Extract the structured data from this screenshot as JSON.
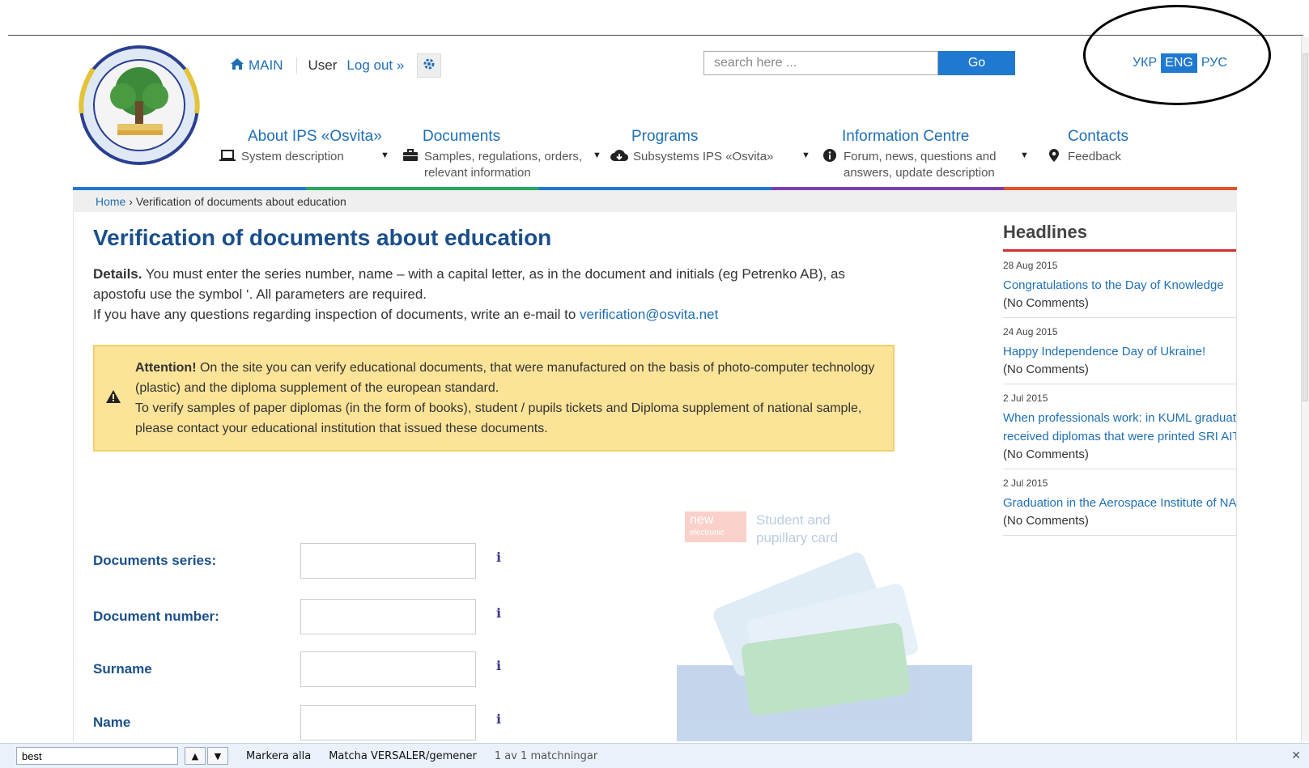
{
  "header": {
    "main_label": "MAIN",
    "user_label": "User",
    "logout_label": "Log out »",
    "search_placeholder": "search here ...",
    "search_button": "Go",
    "languages": [
      "УКР",
      "ENG",
      "РУС"
    ],
    "active_language": "ENG"
  },
  "nav": [
    {
      "title": "About IPS «Osvita»",
      "sub": "System description",
      "icon": "laptop-icon"
    },
    {
      "title": "Documents",
      "sub": "Samples, regulations, orders, relevant information",
      "icon": "briefcase-icon"
    },
    {
      "title": "Programs",
      "sub": "Subsystems IPS «Osvita»",
      "icon": "cloud-download-icon"
    },
    {
      "title": "Information Centre",
      "sub": "Forum, news, questions and answers, update description",
      "icon": "info-circle-icon"
    },
    {
      "title": "Contacts",
      "sub": "Feedback",
      "icon": "map-marker-icon"
    }
  ],
  "nav_colors": [
    "#1f79d0",
    "#2aa860",
    "#1f79d0",
    "#7b3fb0",
    "#e0532a"
  ],
  "breadcrumb": {
    "home": "Home",
    "separator": "›",
    "current": "Verification of documents about education"
  },
  "page": {
    "title": "Verification of documents about education",
    "details_bold": "Details.",
    "details_text": "You must enter the series number, name – with a capital letter, as in the document and initials (eg Petrenko AB), as apostofu use the symbol ‘. All parameters are required.",
    "contact_text": "If you have any questions regarding inspection of documents, write an e-mail to",
    "contact_email": "verification@osvita.net"
  },
  "alert": {
    "bold": "Attention!",
    "line1": "On the site you can verify educational documents, that were manufactured on the basis of photo-computer technology (plastic) and the diploma supplement of the european standard.",
    "line2": "To verify samples of paper diplomas (in the form of books), student / pupils tickets and Diploma supplement of national sample, please contact your educational institution that issued these documents."
  },
  "form": {
    "fields": [
      "Documents series:",
      "Document number:",
      "Surname",
      "Name"
    ],
    "info_symbol": "i"
  },
  "promo": {
    "new": "new",
    "electronic": "electronic",
    "text1": "Student and",
    "text2": "pupillary card"
  },
  "sidebar": {
    "title": "Headlines",
    "news": [
      {
        "date": "28 Aug 2015",
        "title": "Congratulations to the Day of Knowledge",
        "comments": "(No Comments)"
      },
      {
        "date": "24 Aug 2015",
        "title": "Happy Independence Day of Ukraine!",
        "comments": "(No Comments)"
      },
      {
        "date": "2 Jul 2015",
        "title": "When professionals work: in KUML graduates received diplomas that were printed SRI AIT",
        "comments": "(No Comments)"
      },
      {
        "date": "2 Jul 2015",
        "title": "Graduation in the Aerospace Institute of NAU",
        "comments": "(No Comments)"
      }
    ]
  },
  "findbar": {
    "query": "best",
    "highlight_all": "Markera alla",
    "match_case": "Matcha VERSALER/gemener",
    "result": "1 av 1 matchningar"
  }
}
